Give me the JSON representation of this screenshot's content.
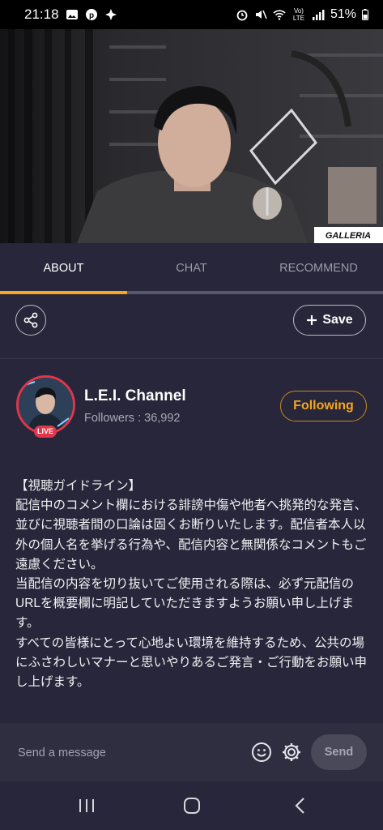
{
  "status_bar": {
    "time": "21:18",
    "battery": "51%",
    "network": "Vo) LTE"
  },
  "video": {
    "overlay_brand": "GALLERIA"
  },
  "tabs": [
    {
      "label": "ABOUT",
      "active": true
    },
    {
      "label": "CHAT",
      "active": false
    },
    {
      "label": "RECOMMEND",
      "active": false
    }
  ],
  "actions": {
    "save_label": "Save"
  },
  "channel": {
    "name": "L.E.I. Channel",
    "followers": "Followers : 36,992",
    "live_badge": "LIVE",
    "follow_label": "Following"
  },
  "description": [
    "【視聴ガイドライン】",
    "配信中のコメント欄における誹謗中傷や他者へ挑発的な発言、並びに視聴者間の口論は固くお断りいたします。配信者本人以外の個人名を挙げる行為や、配信内容と無関係なコメントもご遠慮ください。",
    "当配信の内容を切り抜いてご使用される際は、必ず元配信のURLを概要欄に明記していただきますようお願い申し上げます。",
    "すべての皆様にとって心地よい環境を維持するため、公共の場にふさわしいマナーと思いやりあるご発言・ご行動をお願い申し上げます。"
  ],
  "composer": {
    "placeholder": "Send a message",
    "send_label": "Send"
  },
  "colors": {
    "accent": "#f5a623",
    "background": "#27263a",
    "live": "#e0364b"
  }
}
